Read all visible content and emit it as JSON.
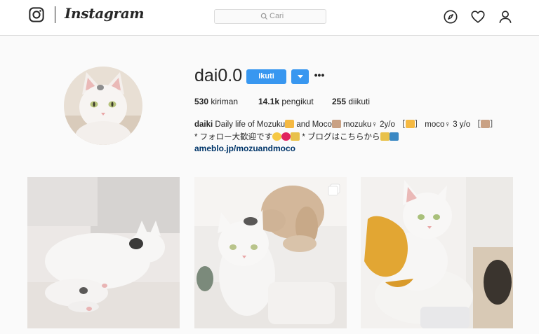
{
  "header": {
    "brand": "Instagram",
    "search_placeholder": "Cari",
    "icons": [
      "instagram-glyph-icon",
      "compass-icon",
      "heart-icon",
      "profile-icon",
      "search-icon"
    ]
  },
  "profile": {
    "username": "dai0.0",
    "follow_label": "Ikuti",
    "more_label": "•••",
    "stats": {
      "posts_count": "530",
      "posts_label": "kiriman",
      "followers_count": "14.1k",
      "followers_label": "pengikut",
      "following_count": "255",
      "following_label": "diikuti"
    },
    "bio_name": "daiki",
    "bio_line1_a": "Daily life of Mozuku",
    "bio_line1_b": " and Moco",
    "bio_line1_c": " mozuku♀ 2y/o ［",
    "bio_line1_d": "］ moco♀ 3 y/o ［",
    "bio_line1_e": "］",
    "bio_line2_a": "* フォロー大歓迎です",
    "bio_line2_b": " * ブログはこちらから",
    "link": "ameblo.jp/mozuandmoco"
  },
  "posts": [
    {
      "type": "image",
      "subject": "white cat lying on sofa"
    },
    {
      "type": "carousel",
      "subject": "white cat with lop rabbit"
    },
    {
      "type": "image",
      "subject": "white cat in yellow sweater"
    }
  ],
  "colors": {
    "accent": "#3897f0",
    "link": "#003569",
    "border": "#dbdbdb",
    "background": "#fafafa"
  }
}
